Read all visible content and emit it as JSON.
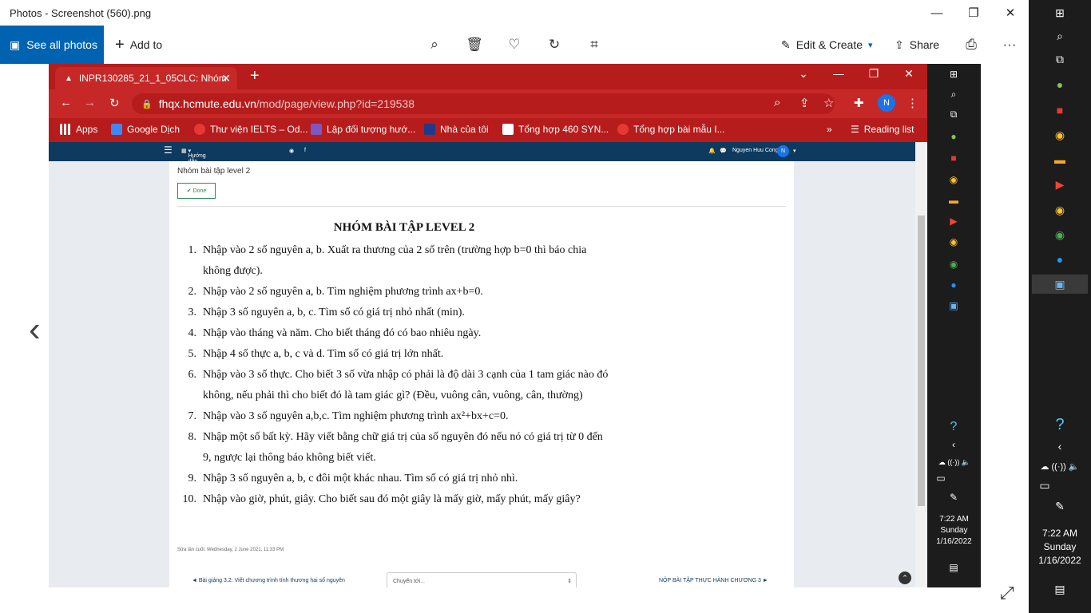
{
  "photos": {
    "title": "Photos - Screenshot (560).png",
    "see_all": "See all photos",
    "add_to": "Add to",
    "edit_create": "Edit & Create",
    "share": "Share",
    "more": "···"
  },
  "browser": {
    "tab_title": "INPR130285_21_1_05CLC: Nhóm",
    "url_host": "fhqx.hcmute.edu.vn",
    "url_path": "/mod/page/view.php?id=219538",
    "profile_letter": "N",
    "bookmarks": [
      {
        "label": "Apps",
        "color": "#4285f4"
      },
      {
        "label": "Google Dịch",
        "color": "#4285f4"
      },
      {
        "label": "Thư viện IELTS – Od...",
        "color": "#e53935"
      },
      {
        "label": "Lập đối tượng hướ...",
        "color": "#7e57c2"
      },
      {
        "label": "Nhà của tôi",
        "color": "#1e3a8a"
      },
      {
        "label": "Tổng hợp 460 SYN...",
        "color": "#ffffff"
      },
      {
        "label": "Tổng hợp bài mẫu I...",
        "color": "#e53935"
      }
    ],
    "more_bookmarks": "»",
    "reading_list": "Reading list"
  },
  "moodle": {
    "nav_guide": "Hướng dẫn (dành cho Giảng viên)",
    "user": "Nguyen Huu Cong",
    "user_initial": "N",
    "breadcrumb": "Nhóm bài tập level 2",
    "done": "✔ Done",
    "doc_title": "NHÓM BÀI TẬP LEVEL 2",
    "exercises": [
      {
        "n": "1.",
        "text": "Nhập vào 2 số nguyên a, b. Xuất ra thương của 2 số trên (trường hợp b=0 thì báo chia không được)."
      },
      {
        "n": "2.",
        "text": "Nhập vào 2 số nguyên a, b. Tìm nghiệm phương trình ax+b=0."
      },
      {
        "n": "3.",
        "text": "Nhập 3 số nguyên a, b, c. Tìm số có giá trị nhỏ nhất (min)."
      },
      {
        "n": "4.",
        "text": "Nhập vào tháng và năm. Cho biết tháng đó có bao nhiêu ngày."
      },
      {
        "n": "5.",
        "text": "Nhập 4 số thực a, b, c và d. Tìm số có giá trị lớn nhất."
      },
      {
        "n": "6.",
        "text": "Nhập vào 3 số thực. Cho biết 3 số vừa nhập có phải là độ dài 3 cạnh của 1 tam giác nào đó không, nếu phải thì cho biết đó là tam giác gì? (Đều, vuông cân, vuông, cân, thường)"
      },
      {
        "n": "7.",
        "text": "Nhập vào 3 số nguyên a,b,c. Tìm nghiệm phương trình ax²+bx+c=0."
      },
      {
        "n": "8.",
        "text": "Nhập một số bất kỳ. Hãy viết bằng chữ giá trị của số nguyên đó nếu nó có giá trị từ 0 đến 9, ngược lại thông báo không biết viết."
      },
      {
        "n": "9.",
        "text": "Nhập 3 số nguyên a, b, c đôi một khác nhau. Tìm số có giá trị nhỏ nhì."
      },
      {
        "n": "10.",
        "text": "Nhập vào giờ, phút, giây. Cho biết sau đó một giây là mấy giờ, mấy phút, mấy giây?"
      }
    ],
    "last_modified": "Sửa lần cuối: Wednesday, 2 June 2021, 11:33 PM",
    "prev_link": "◄ Bài giảng 3.2: Viết chương trình tính thương hai số nguyên",
    "jump_to": "Chuyển tới...",
    "next_link": "NỘP BÀI TẬP THỰC HÀNH CHƯƠNG 3 ►"
  },
  "taskbar": {
    "time": "7:22 AM",
    "day": "Sunday",
    "date": "1/16/2022"
  }
}
